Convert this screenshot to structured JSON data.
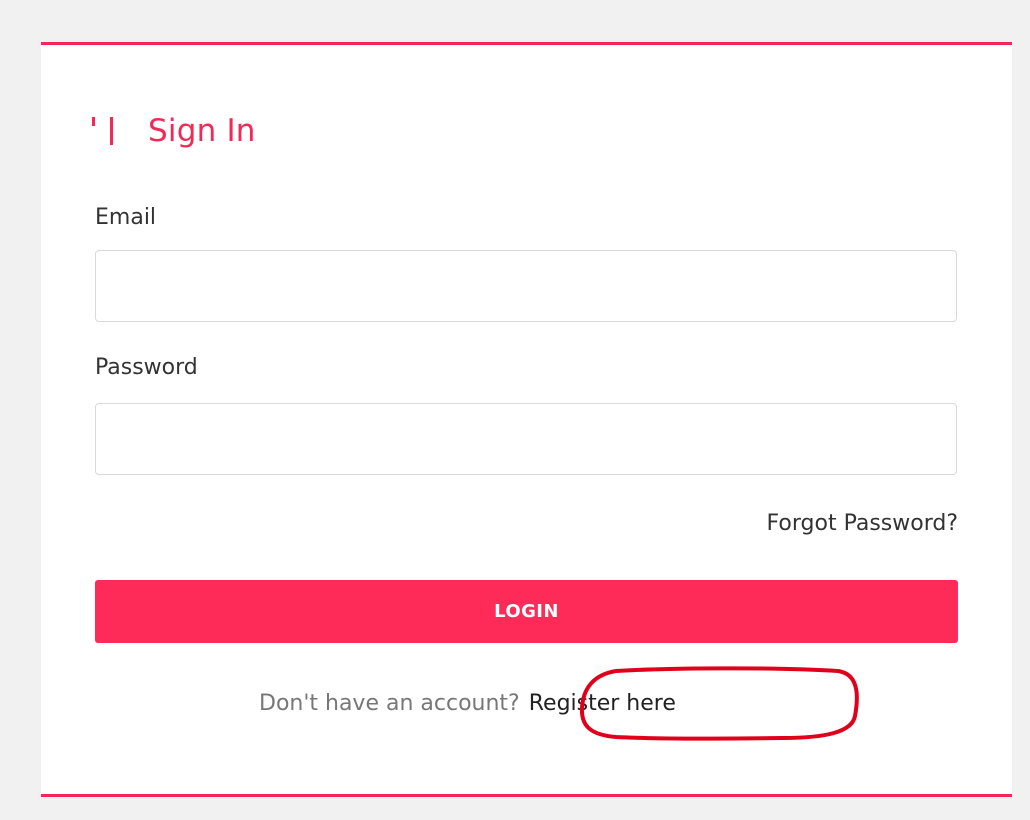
{
  "login": {
    "title": "Sign In",
    "email_label": "Email",
    "email_value": "",
    "password_label": "Password",
    "password_value": "",
    "forgot_label": "Forgot Password?",
    "login_label": "LOGIN",
    "register_prompt": "Don't have an account?",
    "register_link": "Register here"
  },
  "colors": {
    "accent": "#f02a56",
    "button": "#fe2b58",
    "annotation": "#e0001b"
  }
}
